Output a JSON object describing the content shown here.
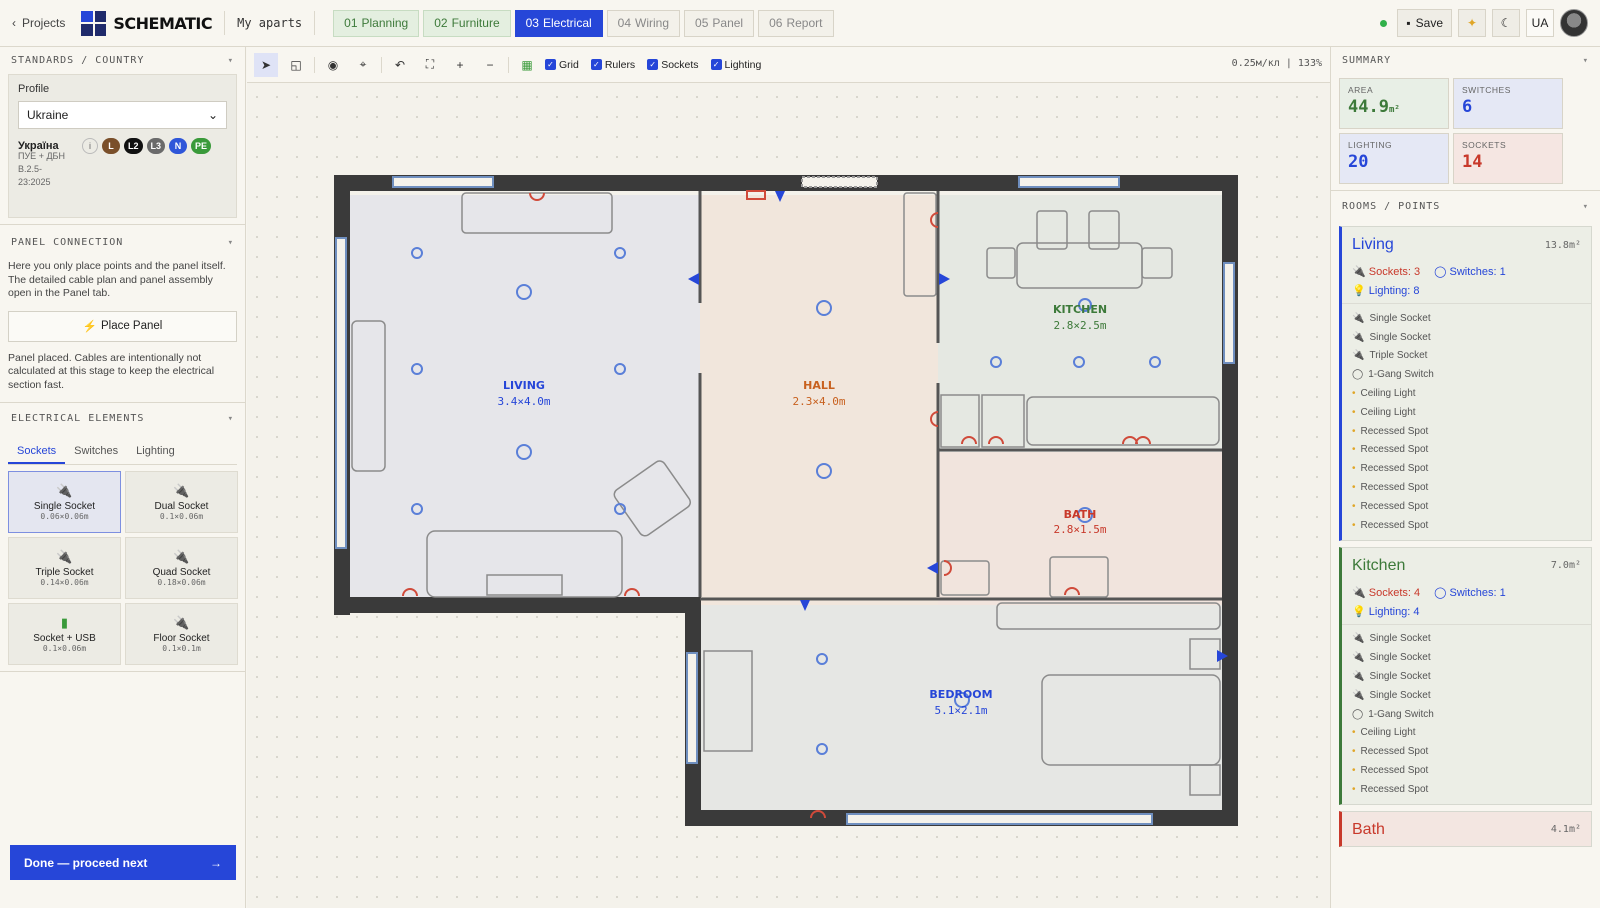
{
  "topbar": {
    "back_label": "Projects",
    "logo_text": "SCHEMATIC",
    "project_name": "My aparts",
    "tabs": [
      {
        "num": "01",
        "label": "Planning",
        "state": "done"
      },
      {
        "num": "02",
        "label": "Furniture",
        "state": "done"
      },
      {
        "num": "03",
        "label": "Electrical",
        "state": "active"
      },
      {
        "num": "04",
        "label": "Wiring",
        "state": "todo"
      },
      {
        "num": "05",
        "label": "Panel",
        "state": "todo"
      },
      {
        "num": "06",
        "label": "Report",
        "state": "todo"
      }
    ],
    "save_label": "Save",
    "lang_label": "UA"
  },
  "left": {
    "standards_title": "STANDARDS / COUNTRY",
    "profile_label": "Profile",
    "profile_value": "Ukraine",
    "country_native": "Україна",
    "standard_text": "ПУЕ + ДБН В.2.5-23:2025",
    "conductors": [
      {
        "label": "L",
        "color": "#7a4f2a"
      },
      {
        "label": "L2",
        "color": "#111111"
      },
      {
        "label": "L3",
        "color": "#6b6b6b"
      },
      {
        "label": "N",
        "color": "#2f56d9"
      },
      {
        "label": "PE",
        "color": "#3a9a3a"
      }
    ],
    "panel_title": "PANEL CONNECTION",
    "panel_text": "Here you only place points and the panel itself. The detailed cable plan and panel assembly open in the Panel tab.",
    "place_panel_label": "Place Panel",
    "panel_status": "Panel placed. Cables are intentionally not calculated at this stage to keep the electrical section fast.",
    "elements_title": "ELECTRICAL ELEMENTS",
    "element_tabs": [
      "Sockets",
      "Switches",
      "Lighting"
    ],
    "elements": [
      {
        "name": "Single Socket",
        "dims": "0.06×0.06m",
        "selected": true
      },
      {
        "name": "Dual Socket",
        "dims": "0.1×0.06m",
        "selected": false
      },
      {
        "name": "Triple Socket",
        "dims": "0.14×0.06m",
        "selected": false
      },
      {
        "name": "Quad Socket",
        "dims": "0.18×0.06m",
        "selected": false
      },
      {
        "name": "Socket + USB",
        "dims": "0.1×0.06m",
        "selected": false
      },
      {
        "name": "Floor Socket",
        "dims": "0.1×0.1m",
        "selected": false
      }
    ],
    "done_label": "Done — proceed next"
  },
  "toolbar": {
    "toggles": [
      {
        "label": "Grid",
        "checked": true
      },
      {
        "label": "Rulers",
        "checked": true
      },
      {
        "label": "Sockets",
        "checked": true
      },
      {
        "label": "Lighting",
        "checked": true
      }
    ],
    "scale_text": "0.25м/кл",
    "zoom_text": "133%"
  },
  "plan": {
    "rooms": [
      {
        "name": "LIVING",
        "dims": "3.4×4.0m",
        "color": "#2646d8"
      },
      {
        "name": "HALL",
        "dims": "2.3×4.0m",
        "color": "#c8611f"
      },
      {
        "name": "KITCHEN",
        "dims": "2.8×2.5m",
        "color": "#3d7a3a"
      },
      {
        "name": "BATH",
        "dims": "2.8×1.5m",
        "color": "#c8392b"
      },
      {
        "name": "BEDROOM",
        "dims": "5.1×2.1m",
        "color": "#2646d8"
      }
    ]
  },
  "summary": {
    "title": "SUMMARY",
    "cards": [
      {
        "label": "AREA",
        "value": "44.9",
        "unit": "m²",
        "color": "#3d7a3a"
      },
      {
        "label": "SWITCHES",
        "value": "6",
        "unit": "",
        "color": "#2646d8"
      },
      {
        "label": "LIGHTING",
        "value": "20",
        "unit": "",
        "color": "#2646d8"
      },
      {
        "label": "SOCKETS",
        "value": "14",
        "unit": "",
        "color": "#c8392b"
      }
    ],
    "rooms_title": "ROOMS / POINTS"
  },
  "rooms_list": [
    {
      "name": "Living",
      "area": "13.8m²",
      "color": "#2646d8",
      "sockets": "Sockets: 3",
      "switches": "Switches: 1",
      "lighting": "Lighting: 8",
      "items": [
        "Single Socket",
        "Single Socket",
        "Triple Socket",
        "1-Gang Switch",
        "Ceiling Light",
        "Ceiling Light",
        "Recessed Spot",
        "Recessed Spot",
        "Recessed Spot",
        "Recessed Spot",
        "Recessed Spot",
        "Recessed Spot"
      ]
    },
    {
      "name": "Kitchen",
      "area": "7.0m²",
      "color": "#3d7a3a",
      "sockets": "Sockets: 4",
      "switches": "Switches: 1",
      "lighting": "Lighting: 4",
      "items": [
        "Single Socket",
        "Single Socket",
        "Single Socket",
        "Single Socket",
        "1-Gang Switch",
        "Ceiling Light",
        "Recessed Spot",
        "Recessed Spot",
        "Recessed Spot"
      ]
    },
    {
      "name": "Bath",
      "area": "4.1m²",
      "color": "#c8392b",
      "sockets": "",
      "switches": "",
      "lighting": "",
      "items": []
    }
  ]
}
